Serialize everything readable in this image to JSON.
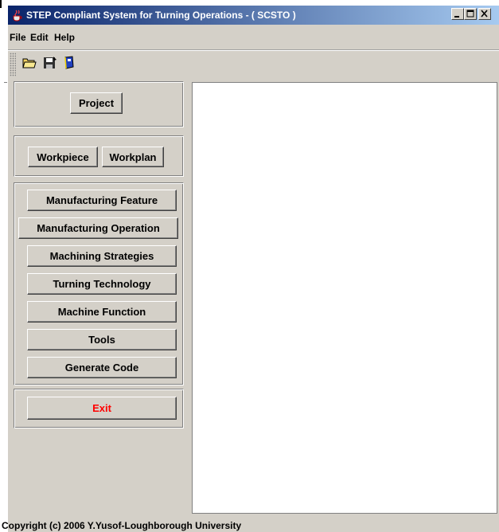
{
  "window": {
    "title": "STEP Compliant System for Turning Operations - ( SCSTO )"
  },
  "menu": {
    "items": [
      "File",
      "Edit",
      "Help"
    ]
  },
  "toolbar": {
    "buttons": [
      "open-folder-icon",
      "save-floppy-icon",
      "book-icon"
    ]
  },
  "left_panel": {
    "project_label": "Project",
    "workpiece_label": "Workpiece",
    "workplan_label": "Workplan",
    "actions": [
      "Manufacturing Feature",
      "Manufacturing Operation",
      "Machining Strategies",
      "Turning Technology",
      "Machine Function",
      "Tools",
      "Generate Code"
    ],
    "exit_label": "Exit"
  },
  "status": {
    "copyright": "Copyright (c) 2006 Y.Yusof-Loughborough University"
  },
  "colors": {
    "title_start": "#0a246a",
    "title_end": "#a6caf0",
    "face": "#d4d0c8",
    "exit_text": "#ff0000"
  }
}
